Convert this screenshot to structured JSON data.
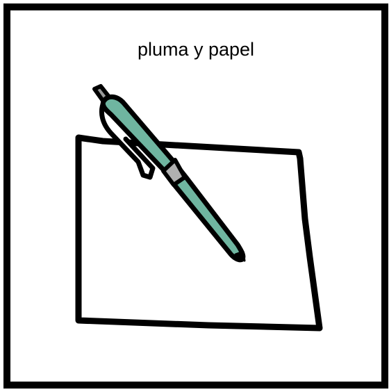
{
  "card": {
    "caption": "pluma y papel",
    "border_color": "#000000",
    "background_color": "#ffffff"
  },
  "illustration": {
    "icons": [
      "paper-icon",
      "pen-icon"
    ],
    "pen_color": "#6fb5a0",
    "pen_band_color": "#b0b0b0",
    "outline_color": "#000000"
  }
}
